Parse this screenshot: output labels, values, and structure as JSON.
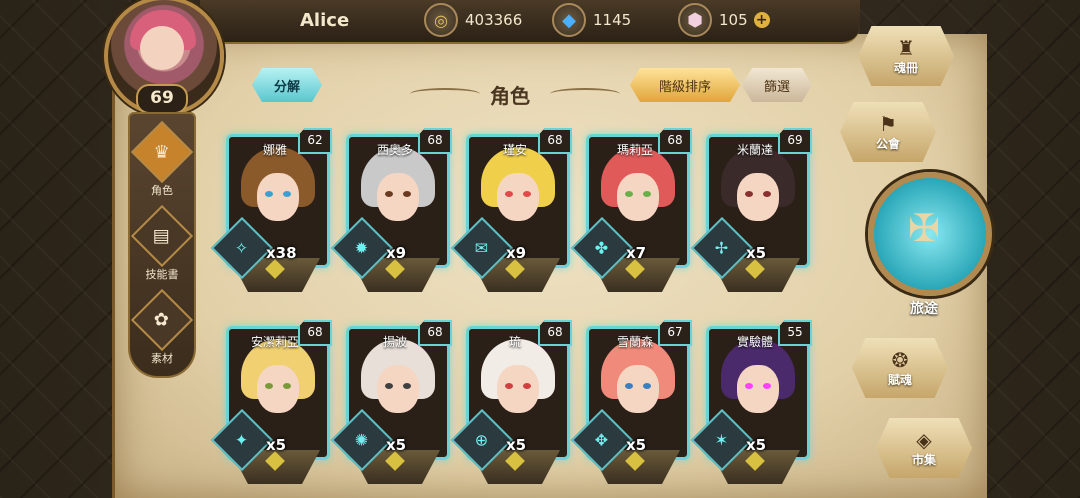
{
  "player": {
    "name": "Alice",
    "level": "69"
  },
  "currency": {
    "gold": "403366",
    "crystal": "1145",
    "gem": "105"
  },
  "header": {
    "title": "角色",
    "decompose": "分解",
    "sort": "階級排序",
    "filter": "篩選"
  },
  "left_nav": [
    {
      "label": "角色",
      "icon": "helmet-icon"
    },
    {
      "label": "技能書",
      "icon": "book-icon"
    },
    {
      "label": "素材",
      "icon": "material-icon"
    }
  ],
  "characters": [
    {
      "name": "娜雅",
      "level": "62",
      "count": "x38",
      "hair": "#8a5a2a",
      "eye": "#3aa0d0"
    },
    {
      "name": "西奧多",
      "level": "68",
      "count": "x9",
      "hair": "#c9c9c9",
      "eye": "#6a3a20"
    },
    {
      "name": "瑾安",
      "level": "68",
      "count": "x9",
      "hair": "#f0d04a",
      "eye": "#e04a4a"
    },
    {
      "name": "瑪莉亞",
      "level": "68",
      "count": "x7",
      "hair": "#e05a5a",
      "eye": "#6ab04a"
    },
    {
      "name": "米蘭達",
      "level": "69",
      "count": "x5",
      "hair": "#3a2a2a",
      "eye": "#8a3030"
    },
    {
      "name": "安潔莉亞",
      "level": "68",
      "count": "x5",
      "hair": "#f0d070",
      "eye": "#7a9a3a"
    },
    {
      "name": "揚波",
      "level": "68",
      "count": "x5",
      "hair": "#e8e0d8",
      "eye": "#404040"
    },
    {
      "name": "琉",
      "level": "68",
      "count": "x5",
      "hair": "#f2ece6",
      "eye": "#d04040"
    },
    {
      "name": "雪蘭森",
      "level": "67",
      "count": "x5",
      "hair": "#f08a7a",
      "eye": "#3a80c0"
    },
    {
      "name": "實驗體",
      "level": "55",
      "count": "x5",
      "hair": "#4a2a6a",
      "eye": "#ff40ff"
    }
  ],
  "right_nav": {
    "soul_book": "魂冊",
    "guild": "公會",
    "journey": "旅途",
    "soul_gift": "賦魂",
    "market": "市集"
  }
}
